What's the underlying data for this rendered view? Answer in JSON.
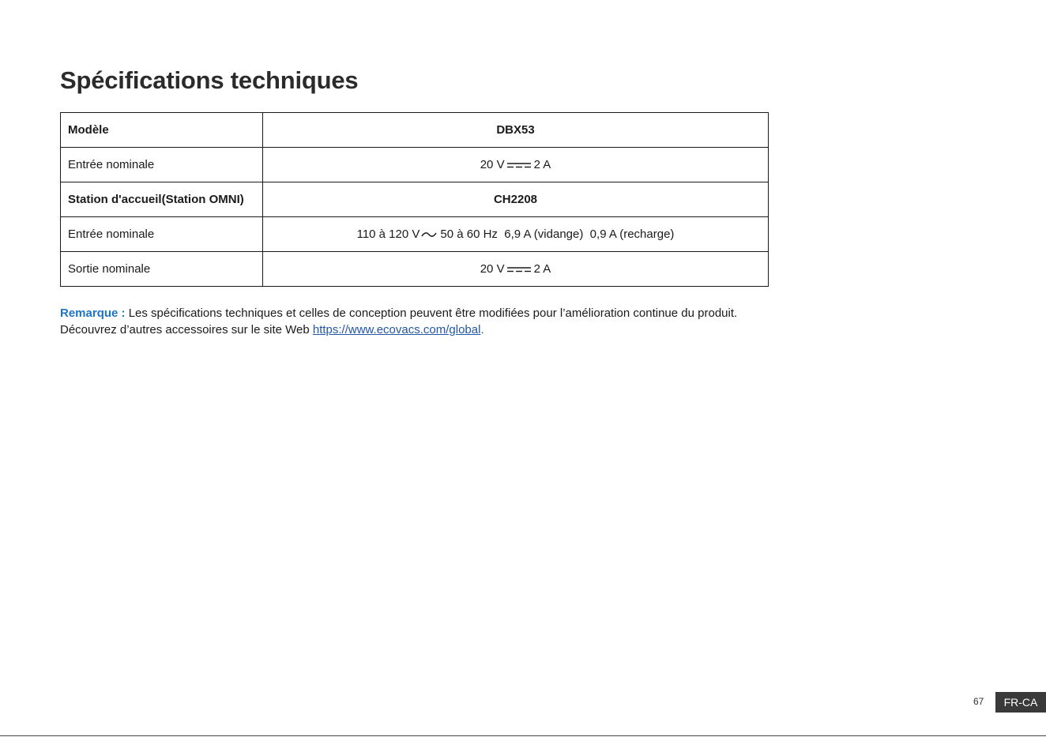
{
  "title": "Spécifications techniques",
  "table": {
    "rows": [
      {
        "label": "Modèle",
        "value": "DBX53"
      },
      {
        "label": "Entrée nominale",
        "value_before": "20 V",
        "symbol": "dc-symbol",
        "value_after": "2 A"
      },
      {
        "label": "Station d'accueil(Station OMNI)",
        "value": "CH2208"
      },
      {
        "label": "Entrée nominale",
        "value_before": "110 à 120 V",
        "symbol": "ac-symbol",
        "value_after": "50 à 60 Hz  6,9 A (vidange)  0,9 A (recharge)"
      },
      {
        "label": "Sortie nominale",
        "value_before": "20 V",
        "symbol": "dc-symbol",
        "value_after": "2 A"
      }
    ]
  },
  "note": {
    "label": "Remarque :",
    "text": " Les spécifications techniques et celles de conception peuvent être modifiées pour l’amélioration continue du produit.",
    "line2": "Découvrez d’autres accessoires sur le site Web ",
    "link": "https://www.ecovacs.com/global",
    "end": "."
  },
  "footer": {
    "page_number": "67",
    "locale": "FR-CA"
  },
  "colors": {
    "note_label": "#1f74c4",
    "link": "#2156a8",
    "badge_bg": "#3a3a3a"
  }
}
